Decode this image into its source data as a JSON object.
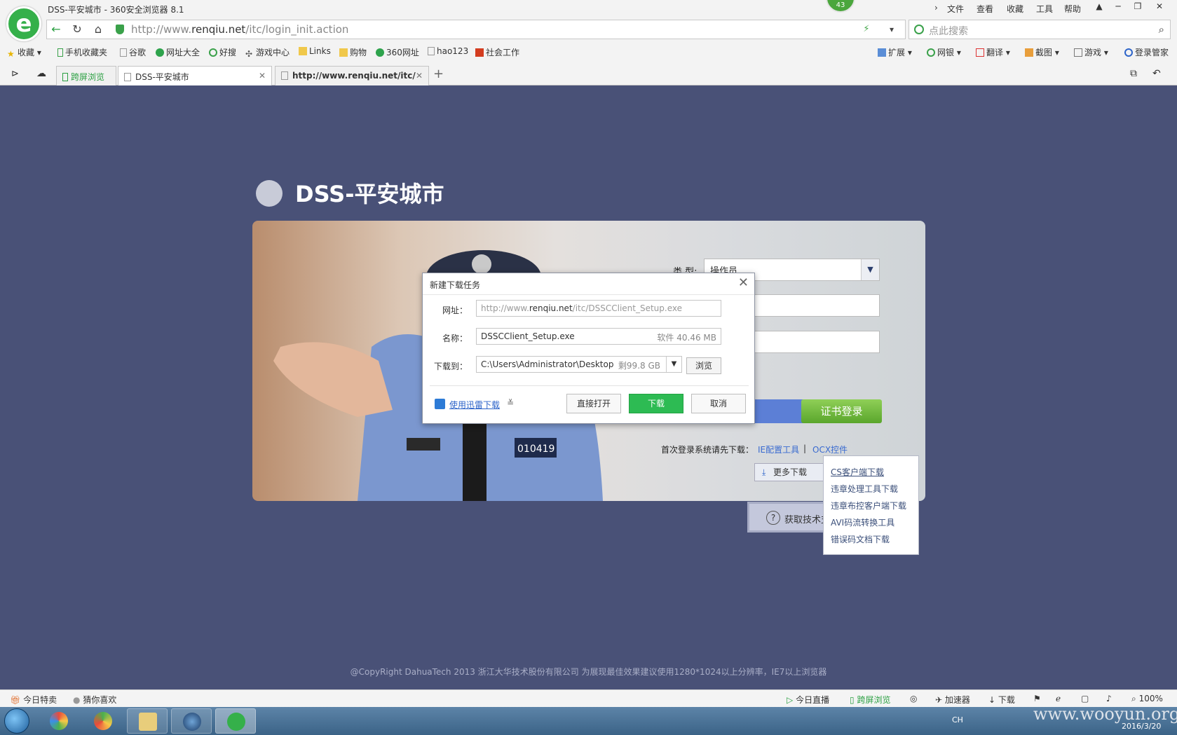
{
  "window": {
    "title": "DSS-平安城市 - 360安全浏览器 8.1",
    "badge": "43"
  },
  "menu": [
    "文件",
    "查看",
    "收藏",
    "工具",
    "帮助"
  ],
  "address": {
    "url_prefix": "http://www.",
    "url_domain": "renqiu.net",
    "url_path": "/itc/login_init.action",
    "search_placeholder": "点此搜索"
  },
  "bookmarks": [
    "收藏",
    "手机收藏夹",
    "谷歌",
    "网址大全",
    "好搜",
    "游戏中心",
    "Links",
    "购物",
    "360网址",
    "hao123",
    "社会工作"
  ],
  "toolbar_right": [
    "扩展",
    "网银",
    "翻译",
    "截图",
    "游戏",
    "登录管家"
  ],
  "tabs": {
    "special": "跨屏浏览",
    "active": "DSS-平安城市",
    "second": "http://www.renqiu.net/itc/"
  },
  "login": {
    "title": "DSS-平安城市",
    "type_label": "类 型:",
    "type_value": "操作员",
    "cert_button": "证书登录",
    "first_login_tip": "首次登录系统请先下载：",
    "ie_tool": "IE配置工具",
    "separator": "|",
    "ocx": "OCX控件",
    "more_downloads": "更多下载",
    "tech_support": "获取技术支",
    "officer_badge": "010419",
    "dl_menu": [
      "CS客户端下载",
      "违章处理工具下载",
      "违章布控客户端下载",
      "AVI码流转换工具",
      "错误码文档下载"
    ]
  },
  "copyright": "@CopyRight DahuaTech 2013 浙江大华技术股份有限公司 为展现最佳效果建议使用1280*1024以上分辨率，IE7以上浏览器",
  "dialog": {
    "title": "新建下载任务",
    "url_label": "网址：",
    "url_prefix": "http://www.",
    "url_domain": "renqiu.net",
    "url_path": "/itc/DSSCClient_Setup.exe",
    "name_label": "名称：",
    "name_value": "DSSCClient_Setup.exe",
    "name_size": "软件 40.46 MB",
    "dest_label": "下载到：",
    "dest_value": "C:\\Users\\Administrator\\Desktop",
    "dest_free": "剩99.8 GB",
    "browse": "浏览",
    "xunlei": "使用迅雷下载",
    "open_directly": "直接打开",
    "download": "下载",
    "cancel": "取消"
  },
  "statusbar": {
    "left1": "今日特卖",
    "left2": "猜你喜欢",
    "right": [
      "今日直播",
      "跨屏浏览",
      "加速器",
      "下载"
    ],
    "zoom": "100%"
  },
  "taskbar": {
    "lang": "CH",
    "date": "2016/3/20"
  },
  "watermark": "www.wooyun.org"
}
